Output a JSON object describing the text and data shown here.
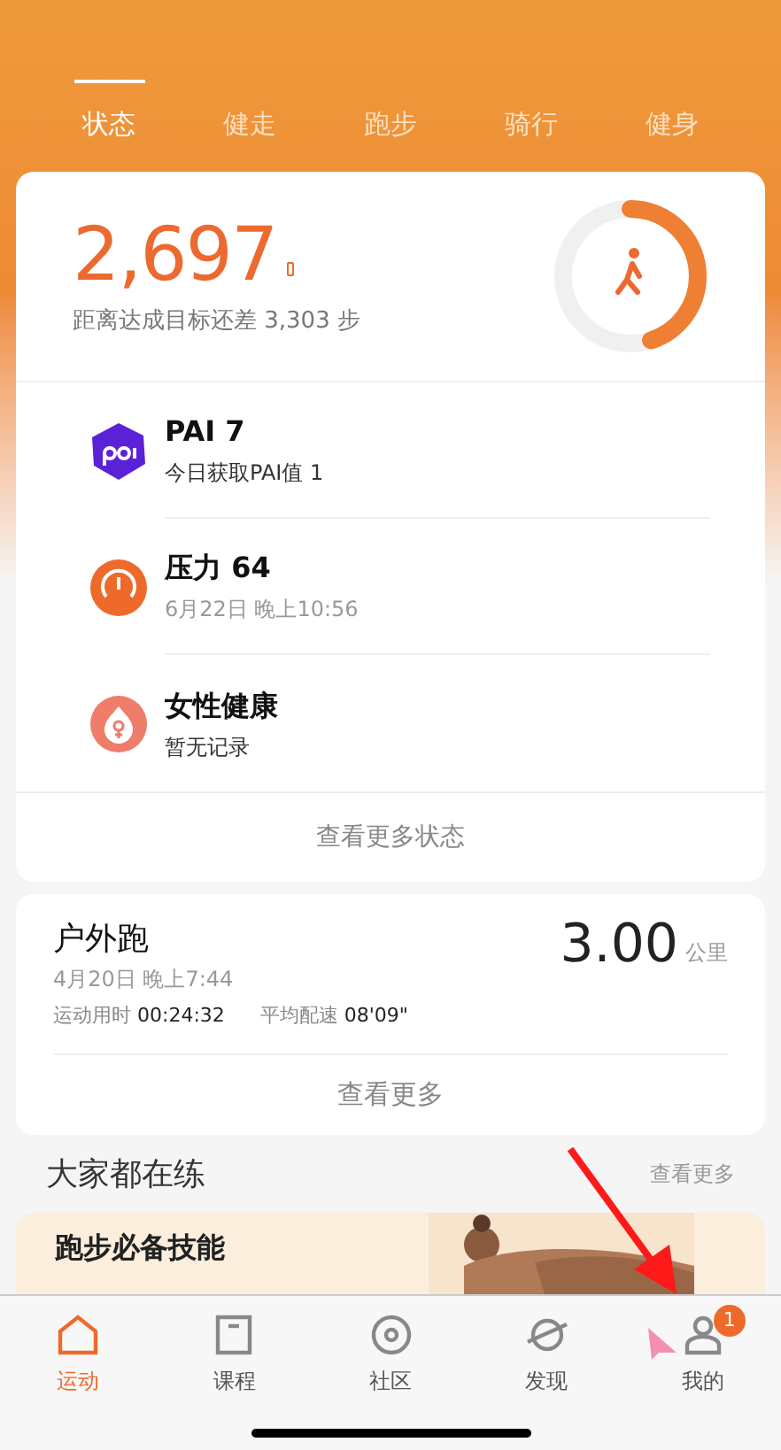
{
  "tabs": [
    {
      "label": "状态",
      "selected": true
    },
    {
      "label": "健走",
      "selected": false
    },
    {
      "label": "跑步",
      "selected": false
    },
    {
      "label": "骑行",
      "selected": false
    },
    {
      "label": "健身",
      "selected": false
    }
  ],
  "summary": {
    "steps": "2,697",
    "remaining": "距离达成目标还差 3,303 步"
  },
  "status_items": [
    {
      "kind": "pai",
      "title": "PAI 7",
      "subtitle": "今日获取PAI值 1",
      "color": "#5b21d6"
    },
    {
      "kind": "stress",
      "title": "压力 64",
      "subtitle": "6月22日 晚上10:56",
      "color": "#ee6a2b"
    },
    {
      "kind": "female",
      "title": "女性健康",
      "subtitle": "暂无记录",
      "color": "#f07d6a"
    }
  ],
  "more_status": "查看更多状态",
  "workout": {
    "title": "户外跑",
    "date": "4月20日 晚上7:44",
    "distance": "3.00",
    "unit": "公里",
    "duration_label": "运动用时",
    "duration": "00:24:32",
    "pace_label": "平均配速",
    "pace": "08'09\"",
    "more": "查看更多"
  },
  "section": {
    "title": "大家都在练",
    "more": "查看更多"
  },
  "banner": {
    "title": "跑步必备技能"
  },
  "nav": [
    {
      "label": "运动",
      "kind": "home",
      "selected": true
    },
    {
      "label": "课程",
      "kind": "course",
      "selected": false
    },
    {
      "label": "社区",
      "kind": "community",
      "selected": false
    },
    {
      "label": "发现",
      "kind": "discover",
      "selected": false
    },
    {
      "label": "我的",
      "kind": "me",
      "selected": false,
      "badge": "1"
    }
  ]
}
